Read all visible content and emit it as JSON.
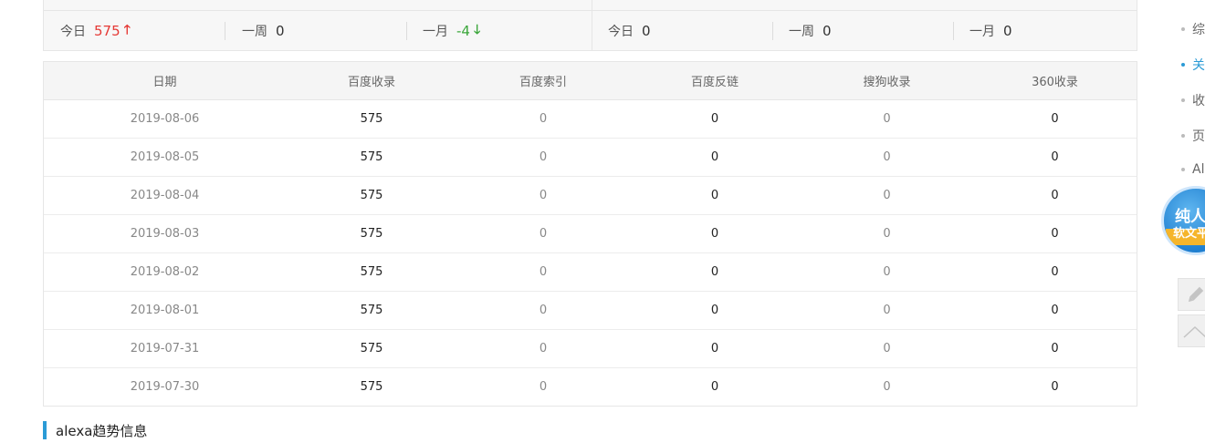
{
  "stats": {
    "left": {
      "today_label": "今日",
      "today_value": "575",
      "week_label": "一周",
      "week_value": "0",
      "month_label": "一月",
      "month_value": "-4"
    },
    "right": {
      "today_label": "今日",
      "today_value": "0",
      "week_label": "一周",
      "week_value": "0",
      "month_label": "一月",
      "month_value": "0"
    },
    "up_arrow": "🡑",
    "down_arrow": "🡓"
  },
  "table": {
    "headers": [
      "日期",
      "百度收录",
      "百度索引",
      "百度反链",
      "搜狗收录",
      "360收录"
    ],
    "rows": [
      [
        "2019-08-06",
        "575",
        "0",
        "0",
        "0",
        "0"
      ],
      [
        "2019-08-05",
        "575",
        "0",
        "0",
        "0",
        "0"
      ],
      [
        "2019-08-04",
        "575",
        "0",
        "0",
        "0",
        "0"
      ],
      [
        "2019-08-03",
        "575",
        "0",
        "0",
        "0",
        "0"
      ],
      [
        "2019-08-02",
        "575",
        "0",
        "0",
        "0",
        "0"
      ],
      [
        "2019-08-01",
        "575",
        "0",
        "0",
        "0",
        "0"
      ],
      [
        "2019-07-31",
        "575",
        "0",
        "0",
        "0",
        "0"
      ],
      [
        "2019-07-30",
        "575",
        "0",
        "0",
        "0",
        "0"
      ]
    ]
  },
  "section": {
    "title": "alexa趋势信息"
  },
  "right_nav": {
    "items": [
      "综",
      "关",
      "收",
      "页",
      "Al"
    ],
    "active_index": 1
  },
  "badge": {
    "line1": "纯人",
    "line2": "软文平"
  },
  "colors": {
    "accent": "#2b9bd6",
    "up": "#e53935",
    "down": "#3aa63a"
  }
}
